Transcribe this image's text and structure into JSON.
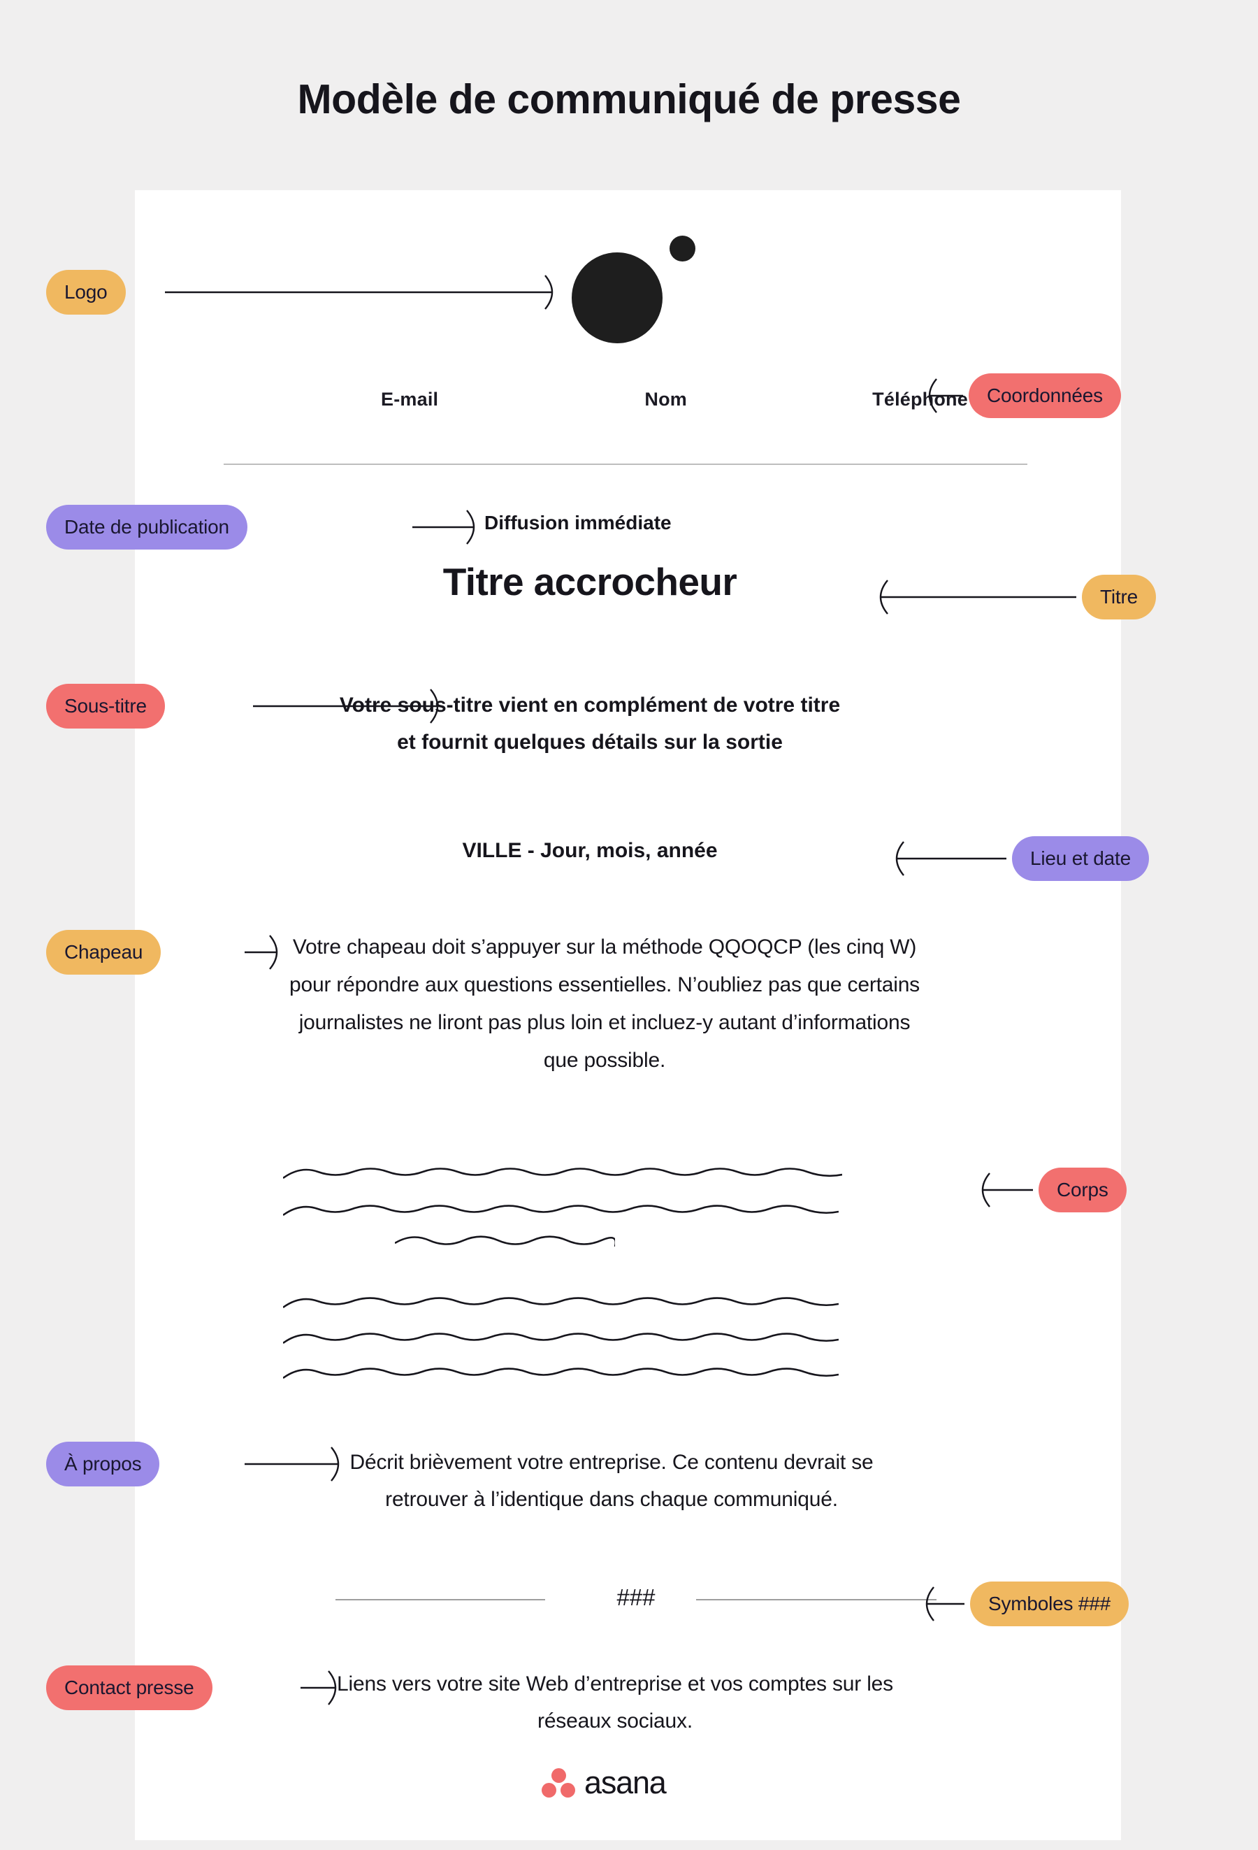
{
  "page": {
    "title": "Modèle de communiqué de presse",
    "background_color": "#F0EFEF",
    "card_color": "#FFFFFF"
  },
  "colors": {
    "yellow": "#F0B860",
    "red": "#F2706F",
    "purple": "#9B8BE8",
    "ink": "#16151C",
    "divider": "#BDBDBD",
    "asana_coral": "#F06A6A"
  },
  "document": {
    "logo": {
      "icon": "circle-logo-mark"
    },
    "contacts": [
      "E-mail",
      "Nom",
      "Téléphone"
    ],
    "release_date": "Diffusion immédiate",
    "headline": "Titre accrocheur",
    "subtitle": "Votre sous-titre vient en complément de votre titre et fournit quelques détails sur la sortie",
    "place_date": "VILLE - Jour, mois, année",
    "lede": "Votre chapeau doit s’appuyer sur la méthode QQOQCP (les cinq W) pour répondre aux questions essentielles. N’oubliez pas que certains journalistes ne liront pas plus loin et incluez-y autant d’informations que possible.",
    "body_lines": 6,
    "about": "Décrit brièvement votre entreprise. Ce contenu devrait se retrouver à l’identique dans chaque communiqué.",
    "hash_symbol": "###",
    "press_contact": "Liens vers votre site Web d’entreprise et vos comptes sur les réseaux sociaux."
  },
  "callouts": {
    "logo": "Logo",
    "coordonnees": "Coordonnées",
    "date_publication": "Date de publication",
    "titre": "Titre",
    "sous_titre": "Sous-titre",
    "lieu_date": "Lieu et date",
    "chapeau": "Chapeau",
    "corps": "Corps",
    "a_propos": "À propos",
    "symboles": "Symboles ###",
    "contact_presse": "Contact presse"
  },
  "footer": {
    "brand": "asana"
  }
}
